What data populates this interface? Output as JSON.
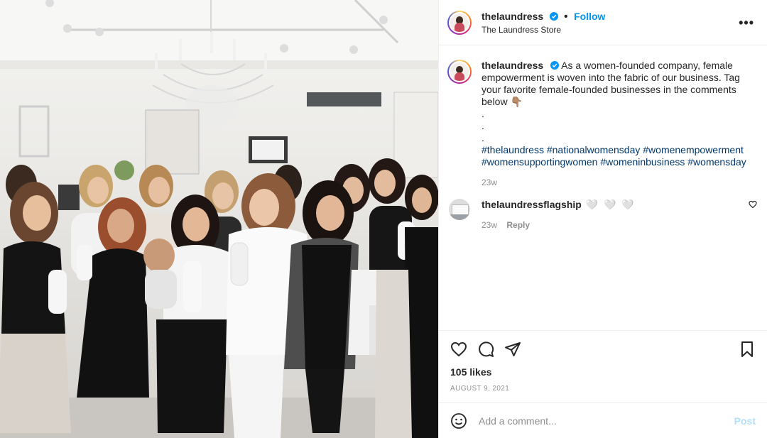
{
  "photo": {
    "alt_icon": "group-photo"
  },
  "header": {
    "username": "thelaundress",
    "separator": "•",
    "follow_label": "Follow",
    "location": "The Laundress Store",
    "more_icon": "more-options-icon"
  },
  "caption": {
    "username": "thelaundress",
    "text": "As a women-founded company, female empowerment is woven into the fabric of our business. Tag your favorite female-founded businesses in the comments below 👇🏽",
    "dots": [
      ".",
      ".",
      "."
    ],
    "hashtags": "#thelaundress #nationalwomensday #womenempowerment #womensupportingwomen #womeninbusiness #womensday",
    "time": "23w"
  },
  "comment": {
    "username": "thelaundressflagship",
    "text": "🤍 🤍 🤍",
    "time": "23w",
    "reply_label": "Reply"
  },
  "actions": {
    "likes": "105 likes",
    "date": "AUGUST 9, 2021"
  },
  "add_comment": {
    "placeholder": "Add a comment...",
    "post_label": "Post"
  },
  "colors": {
    "accent": "#0095f6",
    "hashtag": "#00376b",
    "muted": "#8e8e8e"
  }
}
